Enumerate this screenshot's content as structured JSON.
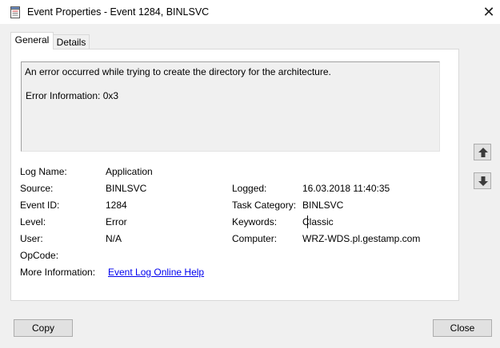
{
  "window": {
    "title": "Event Properties - Event 1284, BINLSVC",
    "close_glyph": "✕"
  },
  "tabs": [
    {
      "label": "General",
      "active": true
    },
    {
      "label": "Details",
      "active": false
    }
  ],
  "message": {
    "line1": "An error occurred while trying to create the directory for the  architecture.",
    "line2": "Error Information: 0x3"
  },
  "fields": {
    "log_name": {
      "label": "Log Name:",
      "value": "Application"
    },
    "source": {
      "label": "Source:",
      "value": "BINLSVC"
    },
    "event_id": {
      "label": "Event ID:",
      "value": "1284"
    },
    "level": {
      "label": "Level:",
      "value": "Error"
    },
    "user": {
      "label": "User:",
      "value": "N/A"
    },
    "opcode": {
      "label": "OpCode:",
      "value": ""
    },
    "more_info": {
      "label": "More Information:",
      "link": "Event Log Online Help"
    },
    "logged": {
      "label": "Logged:",
      "value": "16.03.2018 11:40:35"
    },
    "task_category": {
      "label": "Task Category:",
      "value": "BINLSVC"
    },
    "keywords": {
      "label": "Keywords:",
      "value": "Classic"
    },
    "computer": {
      "label": "Computer:",
      "value": "WRZ-WDS.pl.gestamp.com"
    }
  },
  "buttons": {
    "copy": "Copy",
    "close": "Close"
  },
  "icons": {
    "title": "event-properties-icon",
    "up": "arrow-up-icon",
    "down": "arrow-down-icon"
  }
}
